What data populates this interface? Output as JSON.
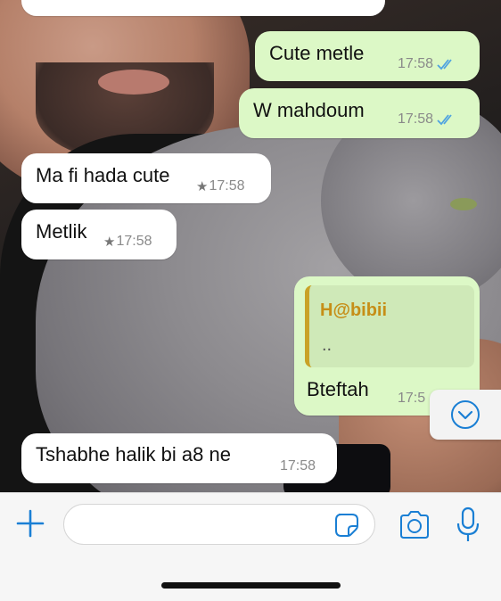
{
  "chat": {
    "messages": [
      {
        "direction": "outgoing",
        "text": "Cute metle",
        "time": "17:58",
        "status_icon": "double-check-read-icon"
      },
      {
        "direction": "outgoing",
        "text": "W mahdoum",
        "time": "17:58",
        "status_icon": "double-check-read-icon"
      },
      {
        "direction": "incoming",
        "text": "Ma fi hada cute",
        "time": "17:58",
        "starred": true
      },
      {
        "direction": "incoming",
        "text": "Metlik",
        "time": "17:58",
        "starred": true
      },
      {
        "direction": "outgoing",
        "text": "Bteftah",
        "time": "17:5",
        "reply": {
          "author": "H@bibii",
          "text": ".."
        }
      },
      {
        "direction": "incoming",
        "text": "Tshabhe halik bi a8 ne",
        "time": "17:58",
        "starred": false
      }
    ],
    "star_glyph": "★",
    "colors": {
      "outgoing_bubble": "#dcf8c6",
      "incoming_bubble": "#ffffff",
      "accent": "#1a7fd4",
      "reply_author": "#c68e17",
      "read_ticks": "#4fa3e0"
    }
  },
  "input_bar": {
    "message_value": "",
    "icons": [
      "plus-icon",
      "sticker-icon",
      "camera-icon",
      "microphone-icon"
    ]
  },
  "scroll_down": {
    "icon": "chevron-down-icon"
  }
}
